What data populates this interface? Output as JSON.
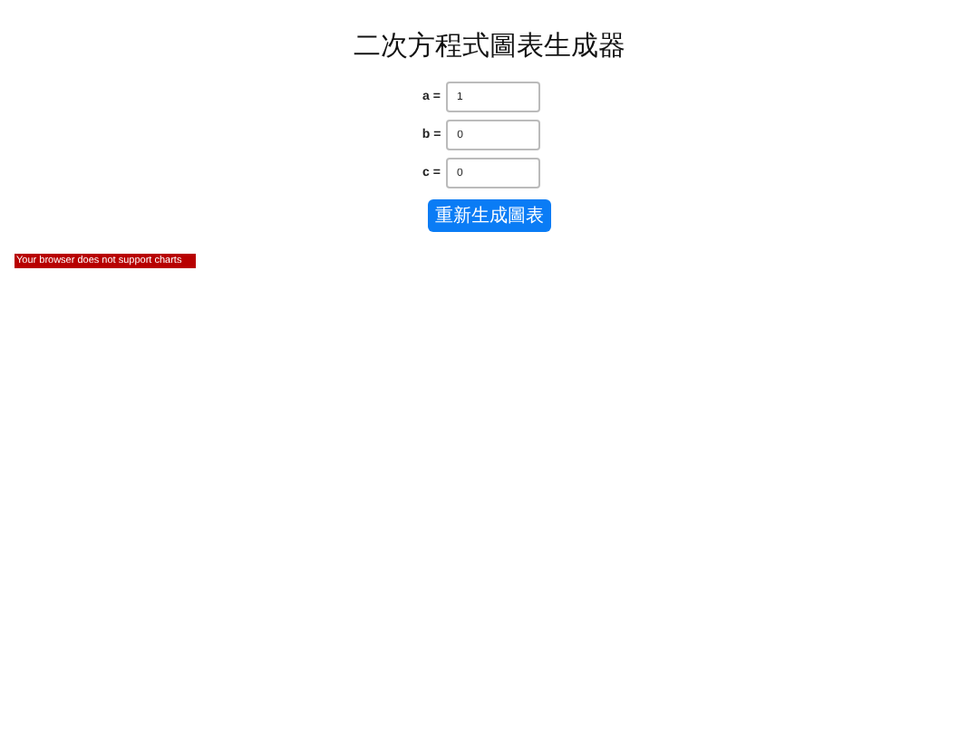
{
  "title": "二次方程式圖表生成器",
  "fields": [
    {
      "label": "a =",
      "value": "1"
    },
    {
      "label": "b =",
      "value": "0"
    },
    {
      "label": "c =",
      "value": "0"
    }
  ],
  "button": "重新生成圖表",
  "error": "Your browser does not support charts"
}
